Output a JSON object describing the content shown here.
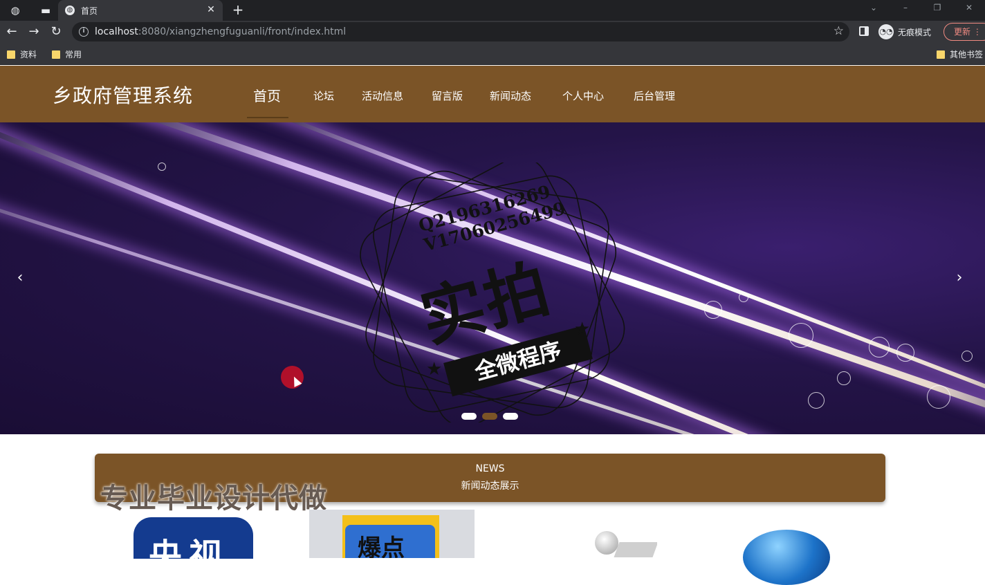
{
  "browser": {
    "tab_title": "首页",
    "url_host": "localhost",
    "url_rest": ":8080/xiangzhengfuguanli/front/index.html",
    "incognito_label": "无痕模式",
    "update_label": "更新",
    "bookmarks": [
      "资料",
      "常用"
    ],
    "other_bookmarks": "其他书签"
  },
  "site": {
    "title": "乡政府管理系统",
    "menu": [
      "首页",
      "论坛",
      "活动信息",
      "留言版",
      "新闻动态",
      "个人中心",
      "后台管理"
    ]
  },
  "banner": {
    "stamp_line1": "Q2196316269",
    "stamp_line2": "V17060256499",
    "stamp_big": "实拍",
    "stamp_ribbon": "全微程序",
    "prev_arrow": "‹",
    "next_arrow": "›",
    "slides": 3,
    "active_slide": 2
  },
  "news": {
    "heading_en": "NEWS",
    "heading_cn": "新闻动态展示"
  },
  "overlay_watermark": "专业毕业设计代做",
  "thumbs": {
    "cctv": "央视",
    "hot": "爆点"
  },
  "colors": {
    "brand_brown": "#7b5427",
    "banner_purple": "#241448"
  }
}
